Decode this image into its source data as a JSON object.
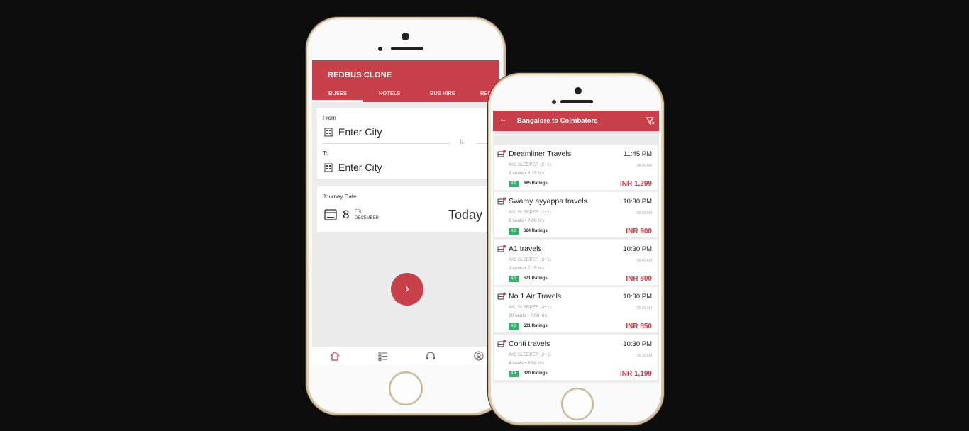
{
  "phone1": {
    "app_title": "REDBUS CLONE",
    "tabs": [
      "BUSES",
      "HOTELS",
      "BUS HIRE",
      "REC"
    ],
    "from_label": "From",
    "from_value": "Enter City",
    "to_label": "To",
    "to_value": "Enter City",
    "journey_label": "Journey Date",
    "date_day": "8",
    "date_weekday": "FRI",
    "date_month": "DECEMBER",
    "date_relative": "Today",
    "go_icon": "›"
  },
  "phone2": {
    "route_title": "Bangalore to Coimbatore",
    "back_icon": "←",
    "buses": [
      {
        "name": "Dreamliner Travels",
        "time": "11:45 PM",
        "type": "A/C SLEEPER (2+1)",
        "arrival": "06:00 AM",
        "seats": "3 seats  •  6:15 hrs",
        "rating": "4.6",
        "ratings": "685 Ratings",
        "price": "INR 1,299"
      },
      {
        "name": "Swamy ayyappa travels",
        "time": "10:30 PM",
        "type": "A/C SLEEPER (2+1)",
        "arrival": "05:30 AM",
        "seats": "6 seats  •  7:00 hrs",
        "rating": "4.3",
        "ratings": "624 Ratings",
        "price": "INR 900"
      },
      {
        "name": "A1   travels",
        "time": "10:30 PM",
        "type": "A/C SLEEPER (2+1)",
        "arrival": "05:45 AM",
        "seats": "3 seats  •  7:15 hrs",
        "rating": "4.1",
        "ratings": "571 Ratings",
        "price": "INR 800"
      },
      {
        "name": "No  1 Air Travels",
        "time": "10:30 PM",
        "type": "A/C SLEEPER (2+1)",
        "arrival": "05:30 AM",
        "seats": "10 seats  •  7:00 hrs",
        "rating": "4.2",
        "ratings": "531 Ratings",
        "price": "INR 850"
      },
      {
        "name": "Conti  travels",
        "time": "10:30 PM",
        "type": "A/C SLEEPER (2+1)",
        "arrival": "05:20 AM",
        "seats": "4 seats  •  6:50 hrs",
        "rating": "4.4",
        "ratings": "320 Ratings",
        "price": "INR 1,199"
      }
    ]
  },
  "colors": {
    "brand": "#c8404a",
    "rating": "#36b36a",
    "background": "#0c0c0c"
  }
}
